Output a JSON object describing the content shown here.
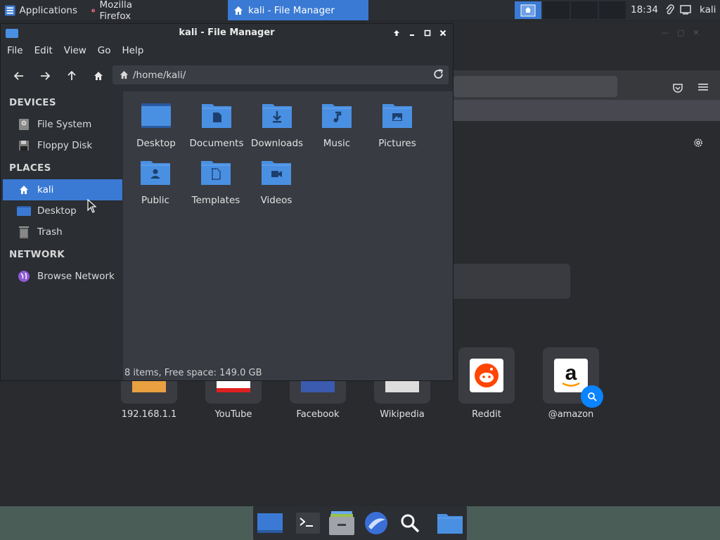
{
  "top_panel": {
    "applications_label": "Applications",
    "tasks": [
      {
        "label": "Mozilla Firefox",
        "active": false
      },
      {
        "label": "kali - File Manager",
        "active": true
      }
    ],
    "clock": "18:34",
    "user": "kali",
    "accent_color": "#3a7ad4"
  },
  "file_manager": {
    "title": "kali - File Manager",
    "menu": [
      "File",
      "Edit",
      "View",
      "Go",
      "Help"
    ],
    "path": "/home/kali/",
    "sidebar": {
      "devices_heading": "DEVICES",
      "devices": [
        "File System",
        "Floppy Disk"
      ],
      "places_heading": "PLACES",
      "places": [
        "kali",
        "Desktop",
        "Trash"
      ],
      "selected_place": "kali",
      "network_heading": "NETWORK",
      "network": [
        "Browse Network"
      ]
    },
    "folders": [
      {
        "label": "Desktop",
        "icon": "desktop-folder-icon"
      },
      {
        "label": "Documents",
        "icon": "documents-folder-icon"
      },
      {
        "label": "Downloads",
        "icon": "downloads-folder-icon"
      },
      {
        "label": "Music",
        "icon": "music-folder-icon"
      },
      {
        "label": "Pictures",
        "icon": "pictures-folder-icon"
      },
      {
        "label": "Public",
        "icon": "public-folder-icon"
      },
      {
        "label": "Templates",
        "icon": "templates-folder-icon"
      },
      {
        "label": "Videos",
        "icon": "videos-folder-icon"
      }
    ],
    "status": "8 items, Free space: 149.0 GB",
    "folder_color": "#4a90e2"
  },
  "firefox": {
    "top_sites": [
      {
        "label": "192.168.1.1"
      },
      {
        "label": "YouTube"
      },
      {
        "label": "Facebook"
      },
      {
        "label": "Wikipedia"
      },
      {
        "label": "Reddit"
      },
      {
        "label": "@amazon"
      }
    ]
  },
  "dock": {
    "items": [
      "desktop-icon",
      "terminal-icon",
      "file-manager-icon",
      "browser-icon",
      "search-icon",
      "folder-icon"
    ]
  }
}
